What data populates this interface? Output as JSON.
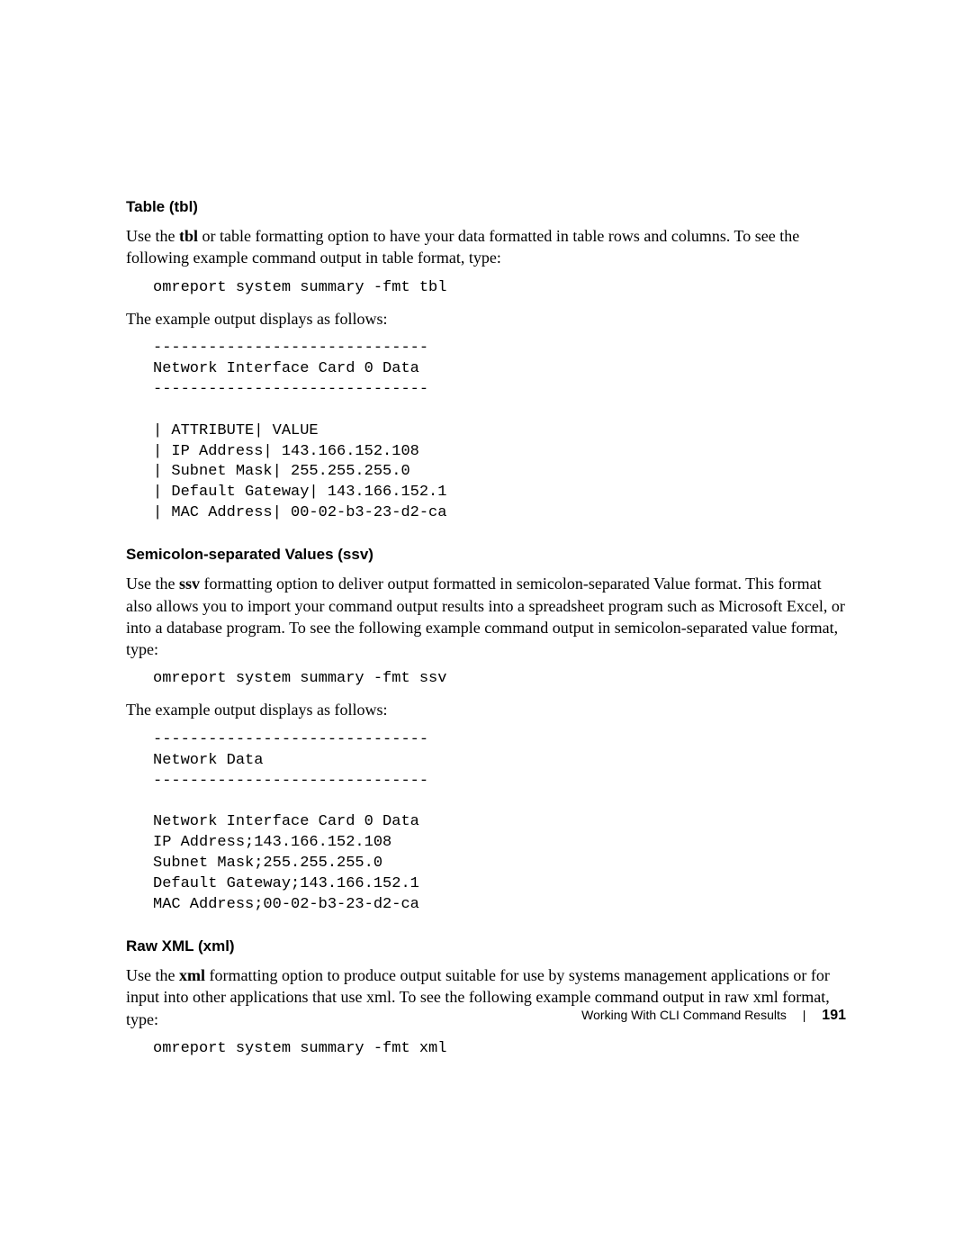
{
  "sections": {
    "tbl": {
      "heading": "Table (tbl)",
      "para1_a": "Use the ",
      "para1_bold": "tbl",
      "para1_b": " or table formatting option to have your data formatted in table rows and columns. To see the following example command output in table format, type:",
      "command": "omreport system summary -fmt tbl",
      "para2": "The example output displays as follows:",
      "output": "------------------------------\nNetwork Interface Card 0 Data\n------------------------------\n\n| ATTRIBUTE| VALUE\n| IP Address| 143.166.152.108\n| Subnet Mask| 255.255.255.0\n| Default Gateway| 143.166.152.1\n| MAC Address| 00-02-b3-23-d2-ca"
    },
    "ssv": {
      "heading": "Semicolon-separated Values (ssv)",
      "para1_a": "Use the ",
      "para1_bold": "ssv",
      "para1_b": " formatting option to deliver output formatted in semicolon-separated Value format. This format also allows you to import your command output results into a spreadsheet program such as Microsoft Excel, or into a database program. To see the following example command output in semicolon-separated value format, type:",
      "command": "omreport system summary -fmt ssv",
      "para2": "The example output displays as follows:",
      "output": "------------------------------\nNetwork Data\n------------------------------\n\nNetwork Interface Card 0 Data\nIP Address;143.166.152.108\nSubnet Mask;255.255.255.0\nDefault Gateway;143.166.152.1\nMAC Address;00-02-b3-23-d2-ca"
    },
    "xml": {
      "heading": "Raw XML (xml)",
      "para1_a": "Use the ",
      "para1_bold": "xml",
      "para1_b": " formatting option to produce output suitable for use by systems management applications or for input into other applications that use xml. To see the following example command output in raw xml format, type:",
      "command": "omreport system summary -fmt xml"
    }
  },
  "footer": {
    "title": "Working With CLI Command Results",
    "sep": "|",
    "page": "191"
  }
}
